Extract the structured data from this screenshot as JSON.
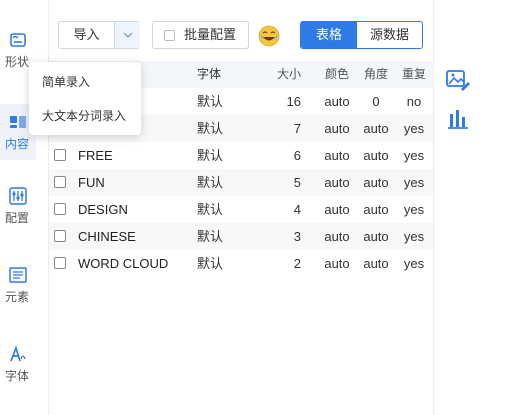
{
  "sidebar": {
    "items": [
      {
        "label": "形状",
        "icon": "shape-icon"
      },
      {
        "label": "内容",
        "icon": "content-icon",
        "active": true
      },
      {
        "label": "配置",
        "icon": "settings-icon"
      },
      {
        "label": "元素",
        "icon": "elements-icon"
      },
      {
        "label": "字体",
        "icon": "font-icon"
      }
    ]
  },
  "toolbar": {
    "import_label": "导入",
    "batch_label": "批量配置",
    "view_tabs": [
      "表格",
      "源数据"
    ],
    "active_tab": "表格",
    "emoji_icon": "laughing-emoji-icon"
  },
  "dropdown": {
    "items": [
      "简单录入",
      "大文本分词录入"
    ]
  },
  "table": {
    "headers": {
      "font": "字体",
      "size": "大小",
      "color": "颜色",
      "angle": "角度",
      "repeat": "重复"
    },
    "rows": [
      {
        "word": "",
        "font": "默认",
        "size": "16",
        "color": "auto",
        "angle": "0",
        "repeat": "no"
      },
      {
        "word": "",
        "font": "默认",
        "size": "7",
        "color": "auto",
        "angle": "auto",
        "repeat": "yes"
      },
      {
        "word": "FREE",
        "font": "默认",
        "size": "6",
        "color": "auto",
        "angle": "auto",
        "repeat": "yes"
      },
      {
        "word": "FUN",
        "font": "默认",
        "size": "5",
        "color": "auto",
        "angle": "auto",
        "repeat": "yes"
      },
      {
        "word": "DESIGN",
        "font": "默认",
        "size": "4",
        "color": "auto",
        "angle": "auto",
        "repeat": "yes"
      },
      {
        "word": "CHINESE",
        "font": "默认",
        "size": "3",
        "color": "auto",
        "angle": "auto",
        "repeat": "yes"
      },
      {
        "word": "WORD CLOUD",
        "font": "默认",
        "size": "2",
        "color": "auto",
        "angle": "auto",
        "repeat": "yes"
      }
    ]
  },
  "right_rail": {
    "icons": [
      "image-edit-icon",
      "bar-chart-icon"
    ]
  },
  "colors": {
    "accent": "#2f7be6",
    "sidebar_active_bg": "#eef3fb",
    "table_header_bg": "#f3f6fa"
  }
}
